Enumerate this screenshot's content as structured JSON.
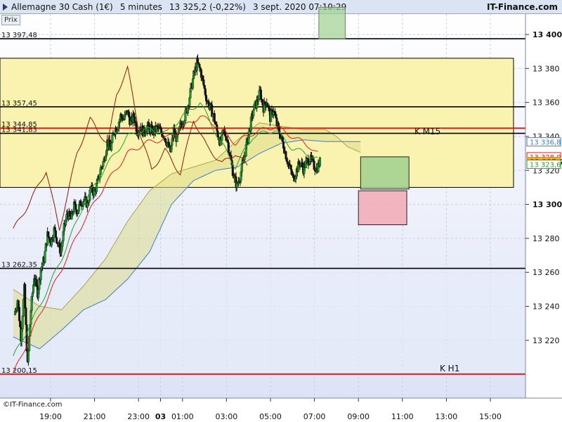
{
  "header": {
    "instrument": "Allemagne 30 Cash (1€)",
    "interval": "5 minutes",
    "last": "13 325,2 (-0,22%)",
    "datetime": "3 sept. 2020 07:10:29",
    "brand": "IT-Finance.com"
  },
  "panel_label": "Prix",
  "footer_copyright": "©IT-Finance.com",
  "colors": {
    "background": "#eef1fb",
    "zone": "#faf3b0",
    "bull": "#1a9e2a",
    "bear": "#111111",
    "red_line": "#e02020",
    "dark_red": "#8b1a0a",
    "blue_line": "#3a7fd0",
    "green_line": "#2aa02a",
    "cloud": "#e6e6a6",
    "green_box": "#9fd08f",
    "pink_box": "#f2a9b4"
  },
  "chart_data": {
    "type": "candlestick",
    "y_range": [
      13186,
      13412
    ],
    "y_ticks": [
      "13 400",
      "13 380",
      "13 360",
      "13 340",
      "13 320",
      "13 300",
      "13 280",
      "13 260",
      "13 240",
      "13 220"
    ],
    "y_tick_values": [
      13400,
      13380,
      13360,
      13340,
      13320,
      13300,
      13280,
      13260,
      13240,
      13220
    ],
    "x_ticks": [
      "19:00",
      "21:00",
      "23:00",
      "03",
      "01:00",
      "03:00",
      "05:00",
      "07:00",
      "09:00",
      "11:00",
      "13:00",
      "15:00"
    ],
    "x_tick_hours": [
      19,
      21,
      23,
      24,
      25,
      27,
      29,
      31,
      33,
      35,
      37,
      39
    ],
    "levels": [
      {
        "value": 13397.48,
        "label": "13 397,48",
        "color": "#000000"
      },
      {
        "value": 13357.45,
        "label": "13 357,45",
        "color": "#000000"
      },
      {
        "value": 13344.85,
        "label": "13 344,85",
        "color": "#e02020"
      },
      {
        "value": 13341.83,
        "label": "13 341,83",
        "color": "#000000"
      },
      {
        "value": 13262.35,
        "label": "13 262,35",
        "color": "#000000"
      },
      {
        "value": 13200.15,
        "label": "13 200,15",
        "color": "#e02020"
      }
    ],
    "zones": [
      {
        "label": "K M15",
        "top": 13386,
        "bottom": 13310
      },
      {
        "label": "K H1",
        "top": 13262.35,
        "bottom": 13200.15
      }
    ],
    "boxes": [
      {
        "name": "green-top",
        "top": 13416,
        "bottom": 13397.5,
        "h_from": 31.2,
        "h_to": 32.4
      },
      {
        "name": "green-mid",
        "top": 13328,
        "bottom": 13309,
        "h_from": 33.1,
        "h_to": 35.3
      },
      {
        "name": "pink",
        "top": 13308,
        "bottom": 13288,
        "h_from": 33.0,
        "h_to": 35.2
      }
    ],
    "price_labels": [
      {
        "value": 13336.8,
        "text": "13 336,8",
        "style": "blue"
      },
      {
        "value": 13328.0,
        "text": "13 328,0",
        "style": "red"
      },
      {
        "value": 13325.2,
        "text": "13 325,2",
        "style": "current"
      },
      {
        "value": 13323.6,
        "text": "13 323,6",
        "style": "green"
      }
    ],
    "candles": {
      "start_hour": 17.35,
      "step_hours": 0.083333,
      "sessions": [
        {
          "close_at": 31.25,
          "points": [
            13235,
            13244,
            13222,
            13250,
            13205,
            13238,
            13258,
            13248,
            13262,
            13268,
            13282,
            13278,
            13285,
            13278,
            13272,
            13286,
            13295,
            13291,
            13299,
            13296,
            13301,
            13303,
            13300,
            13309,
            13307,
            13312,
            13321,
            13326,
            13337,
            13333,
            13343,
            13346,
            13352,
            13350,
            13355,
            13348,
            13352,
            13343,
            13346,
            13342,
            13346,
            13344,
            13343,
            13345,
            13343,
            13341,
            13336,
            13331,
            13343,
            13338,
            13346,
            13350,
            13356,
            13366,
            13376,
            13383,
            13379,
            13370,
            13361,
            13357,
            13352,
            13343,
            13336,
            13343,
            13339,
            13328,
            13317,
            13311,
            13317,
            13326,
            13336,
            13346,
            13356,
            13360,
            13366,
            13357,
            13361,
            13351,
            13356,
            13347,
            13341,
            13335,
            13327,
            13321,
            13315,
            13320,
            13325,
            13321,
            13325,
            13327,
            13323,
            13321,
            13325
          ]
        }
      ]
    },
    "indicators": {
      "tenkan": {
        "color": "#e02020",
        "anchors": [
          [
            17.3,
            13200
          ],
          [
            18.5,
            13235
          ],
          [
            19.5,
            13262
          ],
          [
            20.5,
            13290
          ],
          [
            21.5,
            13312
          ],
          [
            22.5,
            13330
          ],
          [
            23.3,
            13336
          ],
          [
            24.3,
            13339
          ],
          [
            25.0,
            13345
          ],
          [
            25.8,
            13352
          ],
          [
            26.6,
            13346
          ],
          [
            27.4,
            13336
          ],
          [
            28.2,
            13342
          ],
          [
            29.2,
            13346
          ],
          [
            30.0,
            13340
          ],
          [
            30.8,
            13334
          ],
          [
            31.2,
            13329
          ]
        ]
      },
      "kijun": {
        "color": "#2aa02a",
        "anchors": [
          [
            17.3,
            13210
          ],
          [
            18.5,
            13240
          ],
          [
            19.5,
            13268
          ],
          [
            20.5,
            13300
          ],
          [
            21.5,
            13322
          ],
          [
            22.5,
            13340
          ],
          [
            23.3,
            13344
          ],
          [
            24.3,
            13342
          ],
          [
            25.0,
            13352
          ],
          [
            25.8,
            13360
          ],
          [
            26.6,
            13340
          ],
          [
            27.4,
            13322
          ],
          [
            28.2,
            13340
          ],
          [
            29.2,
            13344
          ],
          [
            30.0,
            13333
          ],
          [
            30.8,
            13329
          ],
          [
            31.2,
            13326
          ]
        ]
      },
      "chikou": {
        "color": "#8b1a0a",
        "anchors": [
          [
            17.3,
            13285
          ],
          [
            18.0,
            13300
          ],
          [
            18.8,
            13320
          ],
          [
            19.4,
            13285
          ],
          [
            20.2,
            13330
          ],
          [
            20.8,
            13350
          ],
          [
            21.6,
            13335
          ],
          [
            22.0,
            13365
          ],
          [
            22.5,
            13380
          ],
          [
            23.0,
            13345
          ],
          [
            23.6,
            13320
          ],
          [
            24.2,
            13332
          ],
          [
            24.9,
            13318
          ],
          [
            25.5,
            13350
          ],
          [
            26.1,
            13334
          ],
          [
            26.8,
            13324
          ],
          [
            27.4,
            13330
          ],
          [
            28.0,
            13322
          ]
        ]
      },
      "span_a": [
        [
          17.3,
          13250
        ],
        [
          18.5,
          13240
        ],
        [
          19.5,
          13238
        ],
        [
          20.5,
          13252
        ],
        [
          21.5,
          13268
        ],
        [
          22.5,
          13290
        ],
        [
          23.5,
          13308
        ],
        [
          24.5,
          13318
        ],
        [
          25.5,
          13322
        ],
        [
          26.5,
          13326
        ],
        [
          27.5,
          13338
        ],
        [
          28.5,
          13348
        ],
        [
          29.5,
          13346
        ],
        [
          30.5,
          13344
        ],
        [
          31.5,
          13344
        ],
        [
          32.0,
          13340
        ],
        [
          32.5,
          13334
        ],
        [
          33.2,
          13330
        ]
      ],
      "span_b": [
        [
          17.3,
          13222
        ],
        [
          18.5,
          13215
        ],
        [
          19.5,
          13226
        ],
        [
          20.5,
          13238
        ],
        [
          21.5,
          13244
        ],
        [
          22.5,
          13256
        ],
        [
          23.5,
          13272
        ],
        [
          24.5,
          13300
        ],
        [
          25.5,
          13314
        ],
        [
          26.5,
          13320
        ],
        [
          27.5,
          13322
        ],
        [
          28.5,
          13330
        ],
        [
          29.5,
          13336
        ],
        [
          30.5,
          13338
        ],
        [
          31.5,
          13337
        ],
        [
          32.0,
          13337
        ],
        [
          32.5,
          13337
        ],
        [
          33.2,
          13337
        ]
      ]
    }
  }
}
